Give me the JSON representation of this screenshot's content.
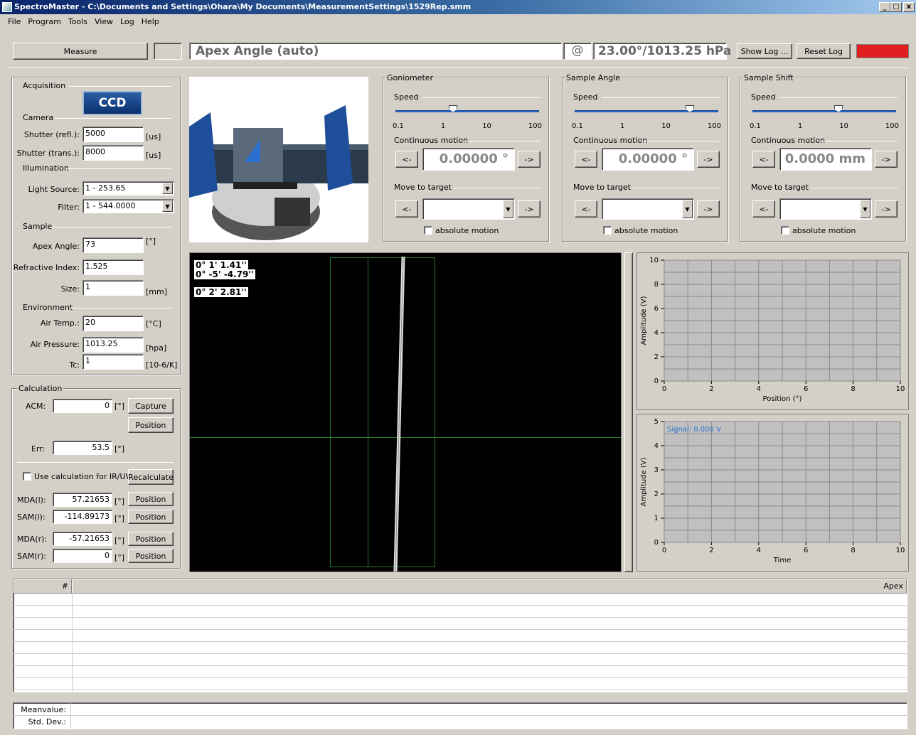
{
  "window": {
    "title": "SpectroMaster - C:\\Documents and Settings\\Ohara\\My Documents\\MeasurementSettings\\1529Rep.smm",
    "min": "_",
    "max": "□",
    "close": "x"
  },
  "menu": [
    "File",
    "Program",
    "Tools",
    "View",
    "Log",
    "Help"
  ],
  "toolbar": {
    "measure_label": "Measure",
    "mode_label": "Apex Angle (auto)",
    "at_symbol": "@",
    "conditions": "23.00°/1013.25 hPa",
    "show_log_label": "Show Log ...",
    "reset_log_label": "Reset Log",
    "status_color": "#e02020"
  },
  "acquisition": {
    "title": "Acquisition",
    "ccd_label": "CCD",
    "camera_title": "Camera",
    "shutter_refl_label": "Shutter (refl.):",
    "shutter_refl_value": "5000",
    "shutter_refl_unit": "[us]",
    "shutter_trans_label": "Shutter (trans.):",
    "shutter_trans_value": "8000",
    "shutter_trans_unit": "[us]",
    "illumination_title": "Illumination",
    "light_source_label": "Light Source:",
    "light_source_value": "1 - 253.65",
    "filter_label": "Filter:",
    "filter_value": "1 - 544.0000",
    "sample_title": "Sample",
    "apex_angle_label": "Apex Angle:",
    "apex_angle_value": "73",
    "apex_angle_unit": "[°]",
    "refractive_index_label": "Refractive Index:",
    "refractive_index_value": "1.525",
    "size_label": "Size:",
    "size_value": "1",
    "size_unit": "[mm]",
    "environment_title": "Environment",
    "air_temp_label": "Air Temp.:",
    "air_temp_value": "20",
    "air_temp_unit": "[°C]",
    "air_pressure_label": "Air Pressure:",
    "air_pressure_value": "1013.25",
    "air_pressure_unit": "[hpa]",
    "tc_label": "Tc:",
    "tc_value": "1",
    "tc_unit": "[10-6/K]"
  },
  "calculation": {
    "title": "Calculation",
    "acm_label": "ACM:",
    "acm_value": "0",
    "deg_unit": "[°]",
    "capture_label": "Capture",
    "position_label": "Position",
    "err_label": "Err:",
    "err_value": "53.5",
    "use_calc_label": "Use calculation for IR/UV",
    "recalculate_label": "Recalculate",
    "mda_l_label": "MDA(l):",
    "mda_l_value": "57.21653",
    "sam_l_label": "SAM(l):",
    "sam_l_value": "-114.89173",
    "mda_r_label": "MDA(r):",
    "mda_r_value": "-57.21653",
    "sam_r_label": "SAM(r):",
    "sam_r_value": "0"
  },
  "motion_panels": [
    {
      "title": "Goniometer",
      "speed_label": "Speed",
      "speed_fraction": 0.4,
      "ticks": [
        "0.1",
        "1",
        "10",
        "100"
      ],
      "continuous_label": "Continuous motion",
      "left": "<-",
      "right": "->",
      "value": "0.00000 °",
      "move_label": "Move to target",
      "absolute_label": "absolute motion"
    },
    {
      "title": "Sample Angle",
      "speed_label": "Speed",
      "speed_fraction": 0.8,
      "ticks": [
        "0.1",
        "1",
        "10",
        "100"
      ],
      "continuous_label": "Continuous motion",
      "left": "<-",
      "right": "->",
      "value": "0.00000 °",
      "move_label": "Move to target",
      "absolute_label": "absolute motion"
    },
    {
      "title": "Sample Shift",
      "speed_label": "Speed",
      "speed_fraction": 0.6,
      "ticks": [
        "0.1",
        "1",
        "10",
        "100"
      ],
      "continuous_label": "Continuous motion",
      "left": "<-",
      "right": "->",
      "value": "0.0000 mm",
      "move_label": "Move to target",
      "absolute_label": "absolute motion"
    }
  ],
  "ccd_view": {
    "overlay1": "0° 1' 1.41''",
    "overlay2": "0° -5' -4.79''",
    "overlay3": "0° 2' 2.81''"
  },
  "chart_data": [
    {
      "type": "line",
      "xlabel": "Position (°)",
      "ylabel": "Amplitude (V)",
      "xlim": [
        0,
        10
      ],
      "ylim": [
        0,
        10
      ],
      "x_ticks": [
        "0",
        "2",
        "4",
        "6",
        "8",
        "10"
      ],
      "y_ticks": [
        "0",
        "2",
        "4",
        "6",
        "8",
        "10"
      ],
      "series": []
    },
    {
      "type": "line",
      "xlabel": "Time",
      "ylabel": "Amplitude (V)",
      "xlim": [
        0,
        10
      ],
      "ylim": [
        0,
        5
      ],
      "x_ticks": [
        "0",
        "2",
        "4",
        "6",
        "8",
        "10"
      ],
      "y_ticks": [
        "0",
        "1",
        "2",
        "3",
        "4",
        "5"
      ],
      "annotation": "Signal: 0.000 V",
      "series": []
    }
  ],
  "results_table": {
    "col_hash": "#",
    "col_apex": "Apex",
    "rows": []
  },
  "stats": {
    "mean_label": "Meanvalue:",
    "std_label": "Std. Dev.:"
  }
}
